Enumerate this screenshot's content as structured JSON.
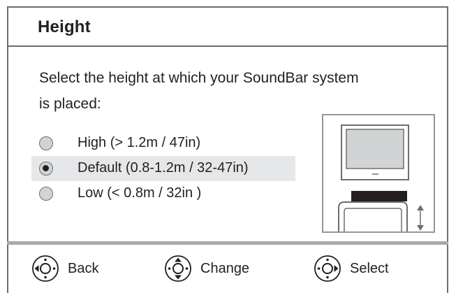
{
  "header": {
    "title": "Height"
  },
  "prompt": {
    "line1": "Select the height at which your SoundBar system",
    "line2": "is placed:"
  },
  "options": [
    {
      "label": "High (> 1.2m / 47in)",
      "checked": false
    },
    {
      "label": "Default (0.8-1.2m / 32-47in)",
      "checked": true
    },
    {
      "label": "Low (< 0.8m / 32in )",
      "checked": false
    }
  ],
  "footer": {
    "back_label": "Back",
    "change_label": "Change",
    "select_label": "Select"
  },
  "colors": {
    "border": "#6d6e71",
    "selected_row": "#e6e7e8",
    "radio_fill": "#d1d3d4",
    "soundbar": "#231f20"
  }
}
